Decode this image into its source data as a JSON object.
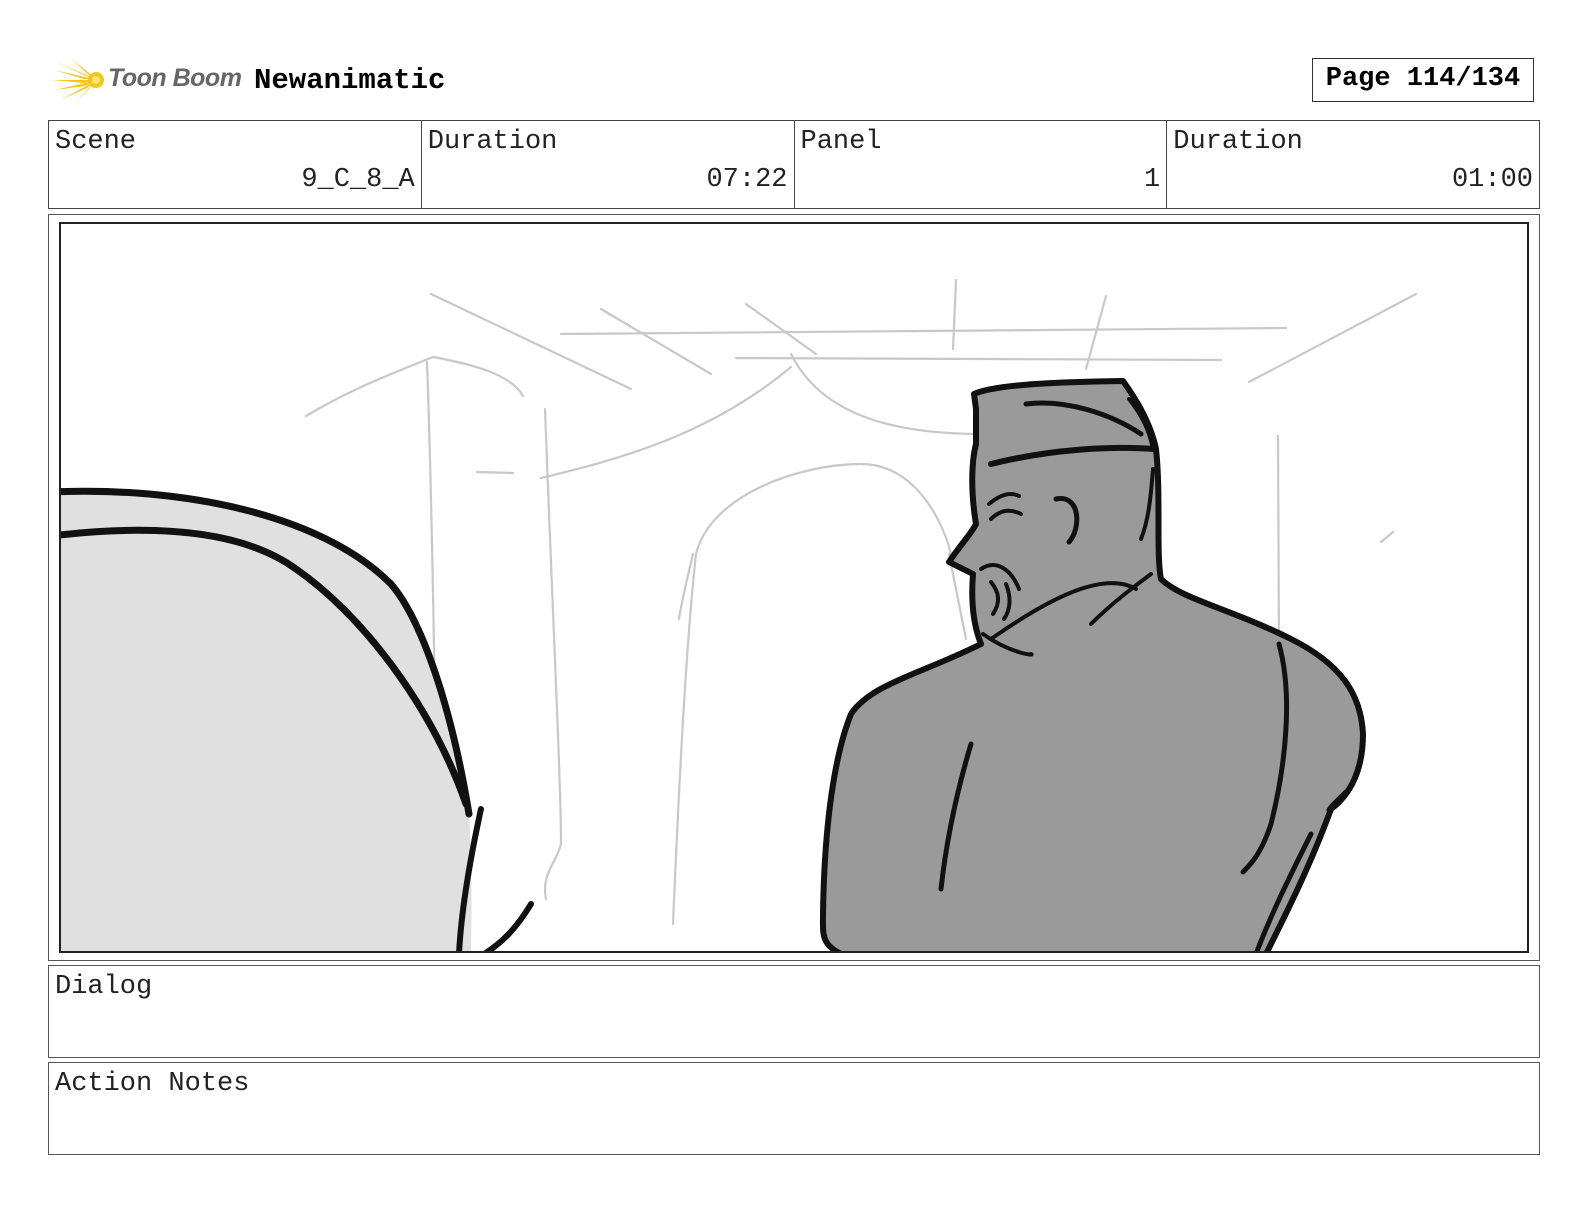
{
  "header": {
    "logo_text": "Toon Boom",
    "project_title": "Newanimatic",
    "page_indicator": "Page 114/134"
  },
  "info": {
    "scene_label": "Scene",
    "scene_value": "9_C_8_A",
    "scene_duration_label": "Duration",
    "scene_duration_value": "07:22",
    "panel_label": "Panel",
    "panel_value": "1",
    "panel_duration_label": "Duration",
    "panel_duration_value": "01:00"
  },
  "dialog": {
    "label": "Dialog",
    "content": ""
  },
  "action_notes": {
    "label": "Action Notes",
    "content": ""
  },
  "colors": {
    "logo_star": "#f5c518",
    "figure_fill": "#9a9a9a",
    "foreground_fill": "#e0e0e0",
    "sketch_lines": "#c8c8c8",
    "ink": "#111111"
  }
}
